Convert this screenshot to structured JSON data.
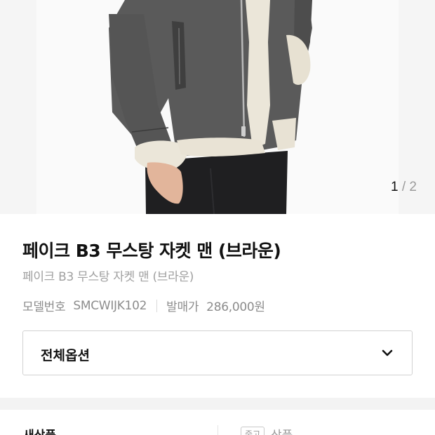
{
  "gallery": {
    "current": "1",
    "separator": "/",
    "total": "2"
  },
  "product": {
    "title": "페이크 B3 무스탕 자켓 맨 (브라운)",
    "subtitle": "페이크 B3 무스탕 자켓 맨 (브라운)",
    "model_label": "모델번호",
    "model_value": "SMCWIJK102",
    "price_label": "발매가",
    "price_value": "286,000원"
  },
  "options": {
    "label": "전체옵션",
    "icon": "chevron-down-icon"
  },
  "tabs": {
    "new_label": "새상품",
    "used_badge": "중고",
    "used_label": "상품"
  },
  "colors": {
    "jacket": "#5b5b5b",
    "shearling": "#ebe6d9",
    "jeans": "#1f1f21",
    "background": "#fafafa"
  }
}
